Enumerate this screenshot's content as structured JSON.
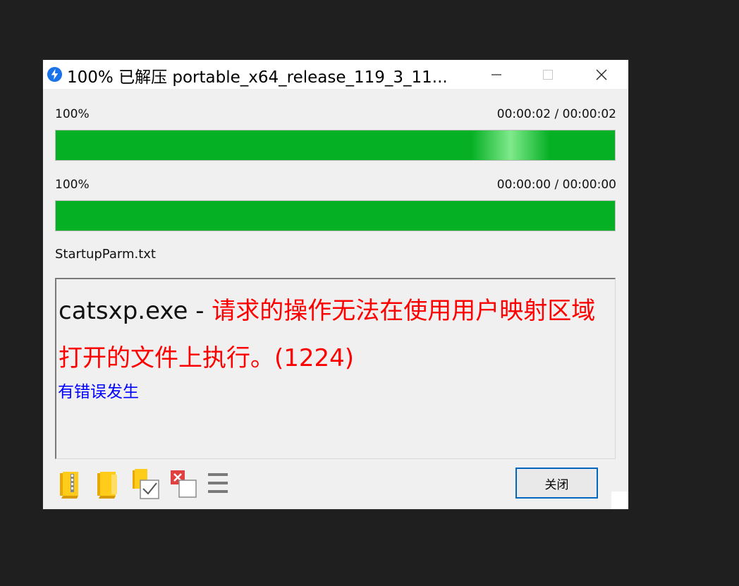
{
  "window": {
    "title": "100% 已解压 portable_x64_release_119_3_11...",
    "icon": "app-blue-circle-icon",
    "controls": {
      "minimize": "minimize-icon",
      "maximize": "maximize-icon",
      "close": "close-icon"
    }
  },
  "progress": [
    {
      "percent_label": "100%",
      "time": "00:00:02  /  00:00:02",
      "value": 1.0
    },
    {
      "percent_label": "100%",
      "time": "00:00:00  /  00:00:00",
      "value": 1.0
    }
  ],
  "current_file": "StartupParm.txt",
  "log": {
    "file": "catsxp.exe - ",
    "message": "请求的操作无法在使用用户映射区域打开的文件上执行。(1224)",
    "status": "有错误发生"
  },
  "toolbar": {
    "icons": [
      "folder-archive-icon",
      "folder-open-icon",
      "folder-check-icon",
      "delete-files-icon",
      "menu-icon"
    ]
  },
  "buttons": {
    "close_label": "关闭"
  },
  "colors": {
    "progress_fill": "#06b025",
    "error_text": "#ff0000",
    "status_text": "#0000ff",
    "accent": "#0067c0"
  }
}
